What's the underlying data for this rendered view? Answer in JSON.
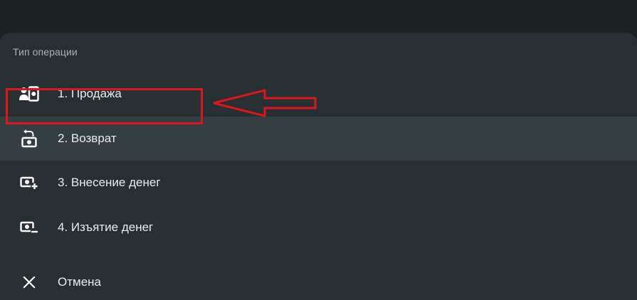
{
  "dialog": {
    "title": "Тип операции",
    "items": [
      {
        "label": "1. Продажа",
        "icon": "sale-person-cash-icon"
      },
      {
        "label": "2. Возврат",
        "icon": "refund-cash-icon"
      },
      {
        "label": "3. Внесение денег",
        "icon": "cash-deposit-icon"
      },
      {
        "label": "4. Изъятие денег",
        "icon": "cash-withdraw-icon"
      }
    ],
    "cancel": {
      "label": "Отмена",
      "icon": "close-icon"
    },
    "selected_index": 1
  },
  "annotation": {
    "color": "#e0141c"
  },
  "colors": {
    "background": "#1b2123",
    "sheet": "#263032",
    "selected_row": "#333e41",
    "text": "#e9eced",
    "muted_text": "#a9b1b3"
  }
}
